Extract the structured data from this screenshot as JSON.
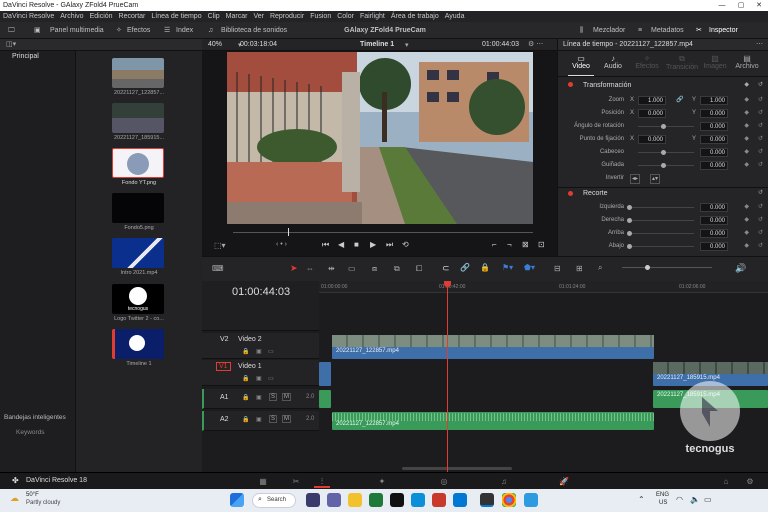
{
  "window": {
    "title": "DaVinci Resolve - GAlaxy ZFold4 PrueCam"
  },
  "menu": [
    "DaVinci Resolve",
    "Archivo",
    "Edición",
    "Recortar",
    "Línea de tiempo",
    "Clip",
    "Marcar",
    "Ver",
    "Reproducir",
    "Fusion",
    "Color",
    "Fairlight",
    "Área de trabajo",
    "Ayuda"
  ],
  "toolbar": {
    "media_pool": "Panel multimedia",
    "effects": "Efectos",
    "index": "Index",
    "sound_library": "Biblioteca de sonidos",
    "project_title": "GAlaxy ZFold4 PrueCam",
    "mixer": "Mezclador",
    "metadata": "Metadatos",
    "inspector": "Inspector"
  },
  "leftbar": {
    "main": "Principal",
    "smart_bins": "Bandejas inteligentes",
    "keywords": "Keywords"
  },
  "media": [
    {
      "label": "20221127_122857...",
      "kind": "video"
    },
    {
      "label": "20221127_185915...",
      "kind": "video"
    },
    {
      "label": "Fondo YT.png",
      "kind": "image"
    },
    {
      "label": "Fondo5.png",
      "kind": "image"
    },
    {
      "label": "Intro 2021.mp4",
      "kind": "video"
    },
    {
      "label": "Logo Twitter 2 - co...",
      "kind": "image"
    },
    {
      "label": "Timeline 1",
      "kind": "timeline"
    }
  ],
  "viewer": {
    "zoom": "40%",
    "timecode_left": "00:03:18:04",
    "timeline_name": "Timeline 1",
    "timecode_right": "01:00:44:03"
  },
  "inspector": {
    "clip_title": "Línea de tiempo - 20221127_122857.mp4",
    "tabs": [
      "Video",
      "Audio",
      "Efectos",
      "Transición",
      "Imagen",
      "Archivo"
    ],
    "transform_title": "Transformación",
    "transform": [
      {
        "label": "Zoom",
        "x": "1.000",
        "y": "1.000"
      },
      {
        "label": "Posición",
        "x": "0.000",
        "y": "0.000"
      },
      {
        "label": "Ángulo de rotación",
        "v": "0.000"
      },
      {
        "label": "Punto de fijación",
        "x": "0.000",
        "y": "0.000"
      },
      {
        "label": "Cabeceo",
        "v": "0.000"
      },
      {
        "label": "Guiñada",
        "v": "0.000"
      },
      {
        "label": "Invertir"
      }
    ],
    "crop_title": "Recorte",
    "crop": [
      {
        "label": "Izquierda",
        "v": "0.000"
      },
      {
        "label": "Derecha",
        "v": "0.000"
      },
      {
        "label": "Arriba",
        "v": "0.000"
      },
      {
        "label": "Abajo",
        "v": "0.000"
      }
    ]
  },
  "timeline": {
    "timecode": "01:00:44:03",
    "ruler": [
      "01:00:00:00",
      "01:00:42:00",
      "01:01:24:00",
      "01:02:06:00"
    ],
    "tracks": [
      {
        "id": "V2",
        "name": "Video 2"
      },
      {
        "id": "V1",
        "name": "Video 1"
      },
      {
        "id": "A1",
        "level": "2.0"
      },
      {
        "id": "A2",
        "level": "2.0"
      }
    ],
    "clips": {
      "v2": "20221127_122857.mp4",
      "v1": "20221127_185915.mp4",
      "a1": "20221127_185915.mp4",
      "a2": "20221127_122857.mp4"
    },
    "playhead_pct": 0.284
  },
  "status": {
    "app": "DaVinci Resolve 18"
  },
  "watermark": "tecnogus",
  "taskbar": {
    "temp": "50°F",
    "weather": "Partly cloudy",
    "search": "Search",
    "lang": "ENG",
    "region": "US"
  },
  "colors": {
    "accent_red": "#e03c31",
    "clip_blue": "#3f6fa8",
    "audio_green": "#3a9a5a"
  }
}
